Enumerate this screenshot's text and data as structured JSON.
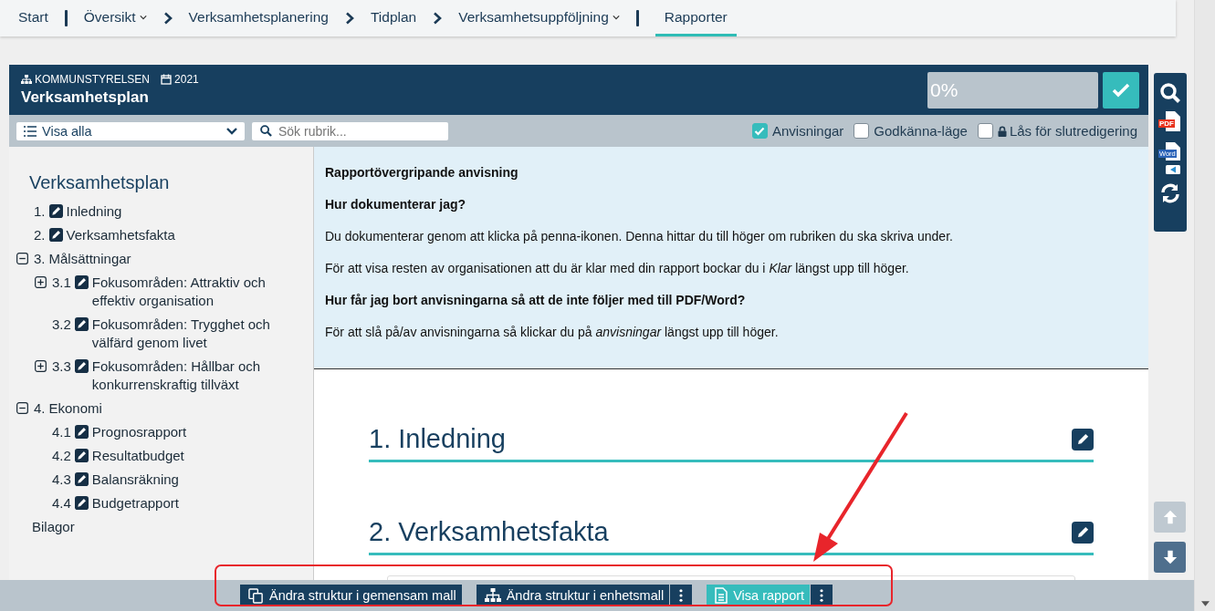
{
  "breadcrumb": [
    {
      "label": "Start",
      "dropdown": false,
      "selected": false
    },
    {
      "label": "Översikt",
      "dropdown": true,
      "selected": false
    },
    {
      "label": "Verksamhetsplanering",
      "dropdown": false,
      "selected": false
    },
    {
      "label": "Tidplan",
      "dropdown": false,
      "selected": false
    },
    {
      "label": "Verksamhetsuppföljning",
      "dropdown": true,
      "selected": false
    },
    {
      "label": "Rapporter",
      "dropdown": false,
      "selected": true
    }
  ],
  "header": {
    "unit": "KOMMUNSTYRELSEN",
    "year": "2021",
    "title": "Verksamhetsplan",
    "progress": {
      "reading": "0%"
    }
  },
  "toolbar": {
    "filter": "Visa alla",
    "search_placeholder": "Sök rubrik...",
    "checkboxes": [
      {
        "label": "Anvisningar",
        "checked": true,
        "locked": false
      },
      {
        "label": "Godkänna-läge",
        "checked": false,
        "locked": false
      },
      {
        "label": "Lås för slutredigering",
        "checked": false,
        "locked": true
      }
    ]
  },
  "outline": {
    "title": "Verksamhetsplan",
    "items": [
      {
        "number": "1.",
        "label": "Inledning",
        "editable": true
      },
      {
        "number": "2.",
        "label": "Verksamhetsfakta",
        "editable": true
      },
      {
        "number": "3.",
        "label": "Målsättningar",
        "editable": false,
        "expanded": true,
        "children": [
          {
            "number": "3.1",
            "label": "Fokusområden: Attraktiv och effektiv organisation",
            "editable": true,
            "expanded": false
          },
          {
            "number": "3.2",
            "label": "Fokusområden: Trygghet och välfärd genom livet",
            "editable": true
          },
          {
            "number": "3.3",
            "label": "Fokusområden: Hållbar och konkurrenskraftig tillväxt",
            "editable": true,
            "expanded": false
          }
        ]
      },
      {
        "number": "4.",
        "label": "Ekonomi",
        "editable": false,
        "expanded": true,
        "children": [
          {
            "number": "4.1",
            "label": "Prognosrapport",
            "editable": true
          },
          {
            "number": "4.2",
            "label": "Resultatbudget",
            "editable": true
          },
          {
            "number": "4.3",
            "label": "Balansräkning",
            "editable": true
          },
          {
            "number": "4.4",
            "label": "Budgetrapport",
            "editable": true
          }
        ]
      },
      {
        "label": "Bilagor",
        "editable": false
      }
    ]
  },
  "instructions": [
    {
      "kind": "heading",
      "text": "Rapportövergripande anvisning"
    },
    {
      "kind": "heading",
      "text": "Hur dokumenterar jag?"
    },
    {
      "kind": "text",
      "text": "Du dokumenterar genom att klicka på penna-ikonen. Denna hittar du till höger om rubriken du ska skriva under."
    },
    {
      "kind": "text",
      "text": "För att visa resten av organisationen att du är klar med din rapport bockar du i *Klar* längst upp till höger."
    },
    {
      "kind": "heading",
      "text": "Hur får jag bort anvisningarna så att de inte följer med till PDF/Word?"
    },
    {
      "kind": "text",
      "text": "För att slå på/av anvisningarna så klickar du på *anvisningar* längst upp till höger."
    }
  ],
  "sections": [
    {
      "title": "1. Inledning"
    },
    {
      "title": "2. Verksamhetsfakta"
    }
  ],
  "tools": {
    "pdf_label": "PDF",
    "word_label": "Word"
  },
  "scroll_buttons": [
    {
      "disabled": true
    },
    {
      "disabled": false
    }
  ],
  "bottom_buttons": [
    {
      "label": "Ändra struktur i gemensam mall",
      "menu": false
    },
    {
      "label": "Ändra struktur i enhetsmall",
      "menu": true
    },
    {
      "label": "Visa rapport",
      "menu": true
    }
  ]
}
